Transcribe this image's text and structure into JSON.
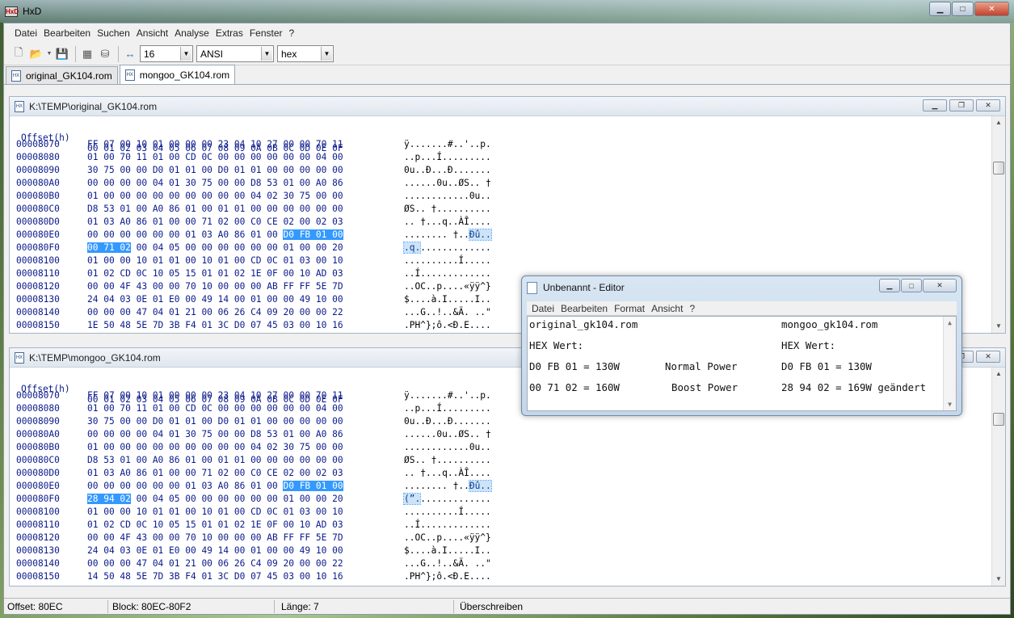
{
  "window": {
    "title": "HxD"
  },
  "menu": [
    "Datei",
    "Bearbeiten",
    "Suchen",
    "Ansicht",
    "Analyse",
    "Extras",
    "Fenster",
    "?"
  ],
  "toolbar": {
    "bytes_per_row": "16",
    "charset": "ANSI",
    "display": "hex"
  },
  "tabs": [
    {
      "label": "original_GK104.rom",
      "active": false
    },
    {
      "label": "mongoo_GK104.rom",
      "active": true
    }
  ],
  "editor1": {
    "title": "K:\\TEMP\\original_GK104.rom",
    "header": {
      "offset": "Offset(h)",
      "cols": "00 01 02 03 04 05 06 07 08 09 0A 0B 0C 0D 0E 0F"
    },
    "rows": [
      {
        "off": "00008070",
        "hex": "FF 07 00 10 01 00 00 00 23 04 10 27 00 00 70 11",
        "asc": "ÿ.......#..'..p."
      },
      {
        "off": "00008080",
        "hex": "01 00 70 11 01 00 CD 0C 00 00 00 00 00 00 04 00",
        "asc": "..p...Í........."
      },
      {
        "off": "00008090",
        "hex": "30 75 00 00 D0 01 01 00 D0 01 01 00 00 00 00 00",
        "asc": "0u..Ð...Ð......."
      },
      {
        "off": "000080A0",
        "hex": "00 00 00 00 04 01 30 75 00 00 D8 53 01 00 A0 86",
        "asc": "......0u..ØS.. †"
      },
      {
        "off": "000080B0",
        "hex": "01 00 00 00 00 00 00 00 00 00 04 02 30 75 00 00",
        "asc": "............0u.."
      },
      {
        "off": "000080C0",
        "hex": "D8 53 01 00 A0 86 01 00 01 01 00 00 00 00 00 00",
        "asc": "ØS.. †.........."
      },
      {
        "off": "000080D0",
        "hex": "01 03 A0 86 01 00 00 71 02 00 C0 CE 02 00 02 03",
        "asc": ".. †...q..ÀÎ...."
      },
      {
        "off": "000080E0",
        "hex": "00 00 00 00 00 00 01 03 A0 86 01 00 ",
        "hexsel": "D0 FB 01 00",
        "asc": "........ †..",
        "ascsel": "Ðû.."
      },
      {
        "off": "000080F0",
        "hexsel": "00 71 02",
        "hex": " 00 04 05 00 00 00 00 00 00 01 00 00 20",
        "ascsel": ".q.",
        "asc": "............."
      },
      {
        "off": "00008100",
        "hex": "01 00 00 10 01 01 00 10 01 00 CD 0C 01 03 00 10",
        "asc": "..........Í....."
      },
      {
        "off": "00008110",
        "hex": "01 02 CD 0C 10 05 15 01 01 02 1E 0F 00 10 AD 03",
        "asc": "..Í............."
      },
      {
        "off": "00008120",
        "hex": "00 00 4F 43 00 00 70 10 00 00 00 AB FF FF 5E 7D",
        "asc": "..OC..p....«ÿÿ^}"
      },
      {
        "off": "00008130",
        "hex": "24 04 03 0E 01 E0 00 49 14 00 01 00 00 49 10 00",
        "asc": "$....à.I.....I.."
      },
      {
        "off": "00008140",
        "hex": "00 00 00 47 04 01 21 00 06 26 C4 09 20 00 00 22",
        "asc": "...G..!..&Ä. ..\""
      },
      {
        "off": "00008150",
        "hex": "1E 50 48 5E 7D 3B F4 01 3C D0 07 45 03 00 10 16",
        "asc": ".PH^};ô.<Ð.E...."
      }
    ]
  },
  "editor2": {
    "title": "K:\\TEMP\\mongoo_GK104.rom",
    "header": {
      "offset": "Offset(h)",
      "cols": "00 01 02 03 04 05 06 07 08 09 0A 0B 0C 0D 0E 0F"
    },
    "rows": [
      {
        "off": "00008070",
        "hex": "FF 07 00 10 01 00 00 00 23 04 10 27 00 00 70 11",
        "asc": "ÿ.......#..'..p."
      },
      {
        "off": "00008080",
        "hex": "01 00 70 11 01 00 CD 0C 00 00 00 00 00 00 04 00",
        "asc": "..p...Í........."
      },
      {
        "off": "00008090",
        "hex": "30 75 00 00 D0 01 01 00 D0 01 01 00 00 00 00 00",
        "asc": "0u..Ð...Ð......."
      },
      {
        "off": "000080A0",
        "hex": "00 00 00 00 04 01 30 75 00 00 D8 53 01 00 A0 86",
        "asc": "......0u..ØS.. †"
      },
      {
        "off": "000080B0",
        "hex": "01 00 00 00 00 00 00 00 00 00 04 02 30 75 00 00",
        "asc": "............0u.."
      },
      {
        "off": "000080C0",
        "hex": "D8 53 01 00 A0 86 01 00 01 01 00 00 00 00 00 00",
        "asc": "ØS.. †.........."
      },
      {
        "off": "000080D0",
        "hex": "01 03 A0 86 01 00 00 71 02 00 C0 CE 02 00 02 03",
        "asc": ".. †...q..ÀÎ...."
      },
      {
        "off": "000080E0",
        "hex": "00 00 00 00 00 00 01 03 A0 86 01 00 ",
        "hexsel": "D0 FB 01 00",
        "asc": "........ †..",
        "ascsel": "Ðû.."
      },
      {
        "off": "000080F0",
        "hexsel": "28 94 02",
        "hex": " 00 04 05 00 00 00 00 00 00 01 00 00 20",
        "ascsel": "(”.",
        "asc": "............."
      },
      {
        "off": "00008100",
        "hex": "01 00 00 10 01 01 00 10 01 00 CD 0C 01 03 00 10",
        "asc": "..........Í....."
      },
      {
        "off": "00008110",
        "hex": "01 02 CD 0C 10 05 15 01 01 02 1E 0F 00 10 AD 03",
        "asc": "..Í............."
      },
      {
        "off": "00008120",
        "hex": "00 00 4F 43 00 00 70 10 00 00 00 AB FF FF 5E 7D",
        "asc": "..OC..p....«ÿÿ^}"
      },
      {
        "off": "00008130",
        "hex": "24 04 03 0E 01 E0 00 49 14 00 01 00 00 49 10 00",
        "asc": "$....à.I.....I.."
      },
      {
        "off": "00008140",
        "hex": "00 00 00 47 04 01 21 00 06 26 C4 09 20 00 00 22",
        "asc": "...G..!..&Ä. ..\""
      },
      {
        "off": "00008150",
        "hex": "14 50 48 5E 7D 3B F4 01 3C D0 07 45 03 00 10 16",
        "asc": ".PH^};ô.<Ð.E...."
      }
    ]
  },
  "status": {
    "offset": "Offset: 80EC",
    "block": "Block: 80EC-80F2",
    "length": "Länge: 7",
    "mode": "Überschreiben"
  },
  "notepad": {
    "title": "Unbenannt - Editor",
    "menu": [
      "Datei",
      "Bearbeiten",
      "Format",
      "Ansicht",
      "?"
    ],
    "lines": {
      "l1a": "original_gk104.rom",
      "l1b": "mongoo_gk104.rom",
      "l2a": "HEX Wert:",
      "l2b": "HEX Wert:",
      "l3a": "D0 FB 01 = 130W",
      "l3m": "Normal Power",
      "l3b": "D0 FB 01 = 130W",
      "l4a": "00 71 02 = 160W",
      "l4m": "Boost Power",
      "l4b": "28 94 02 = 169W geändert"
    }
  },
  "colors": {
    "selection": "#3399ff",
    "hexText": "#0a1a8a"
  }
}
